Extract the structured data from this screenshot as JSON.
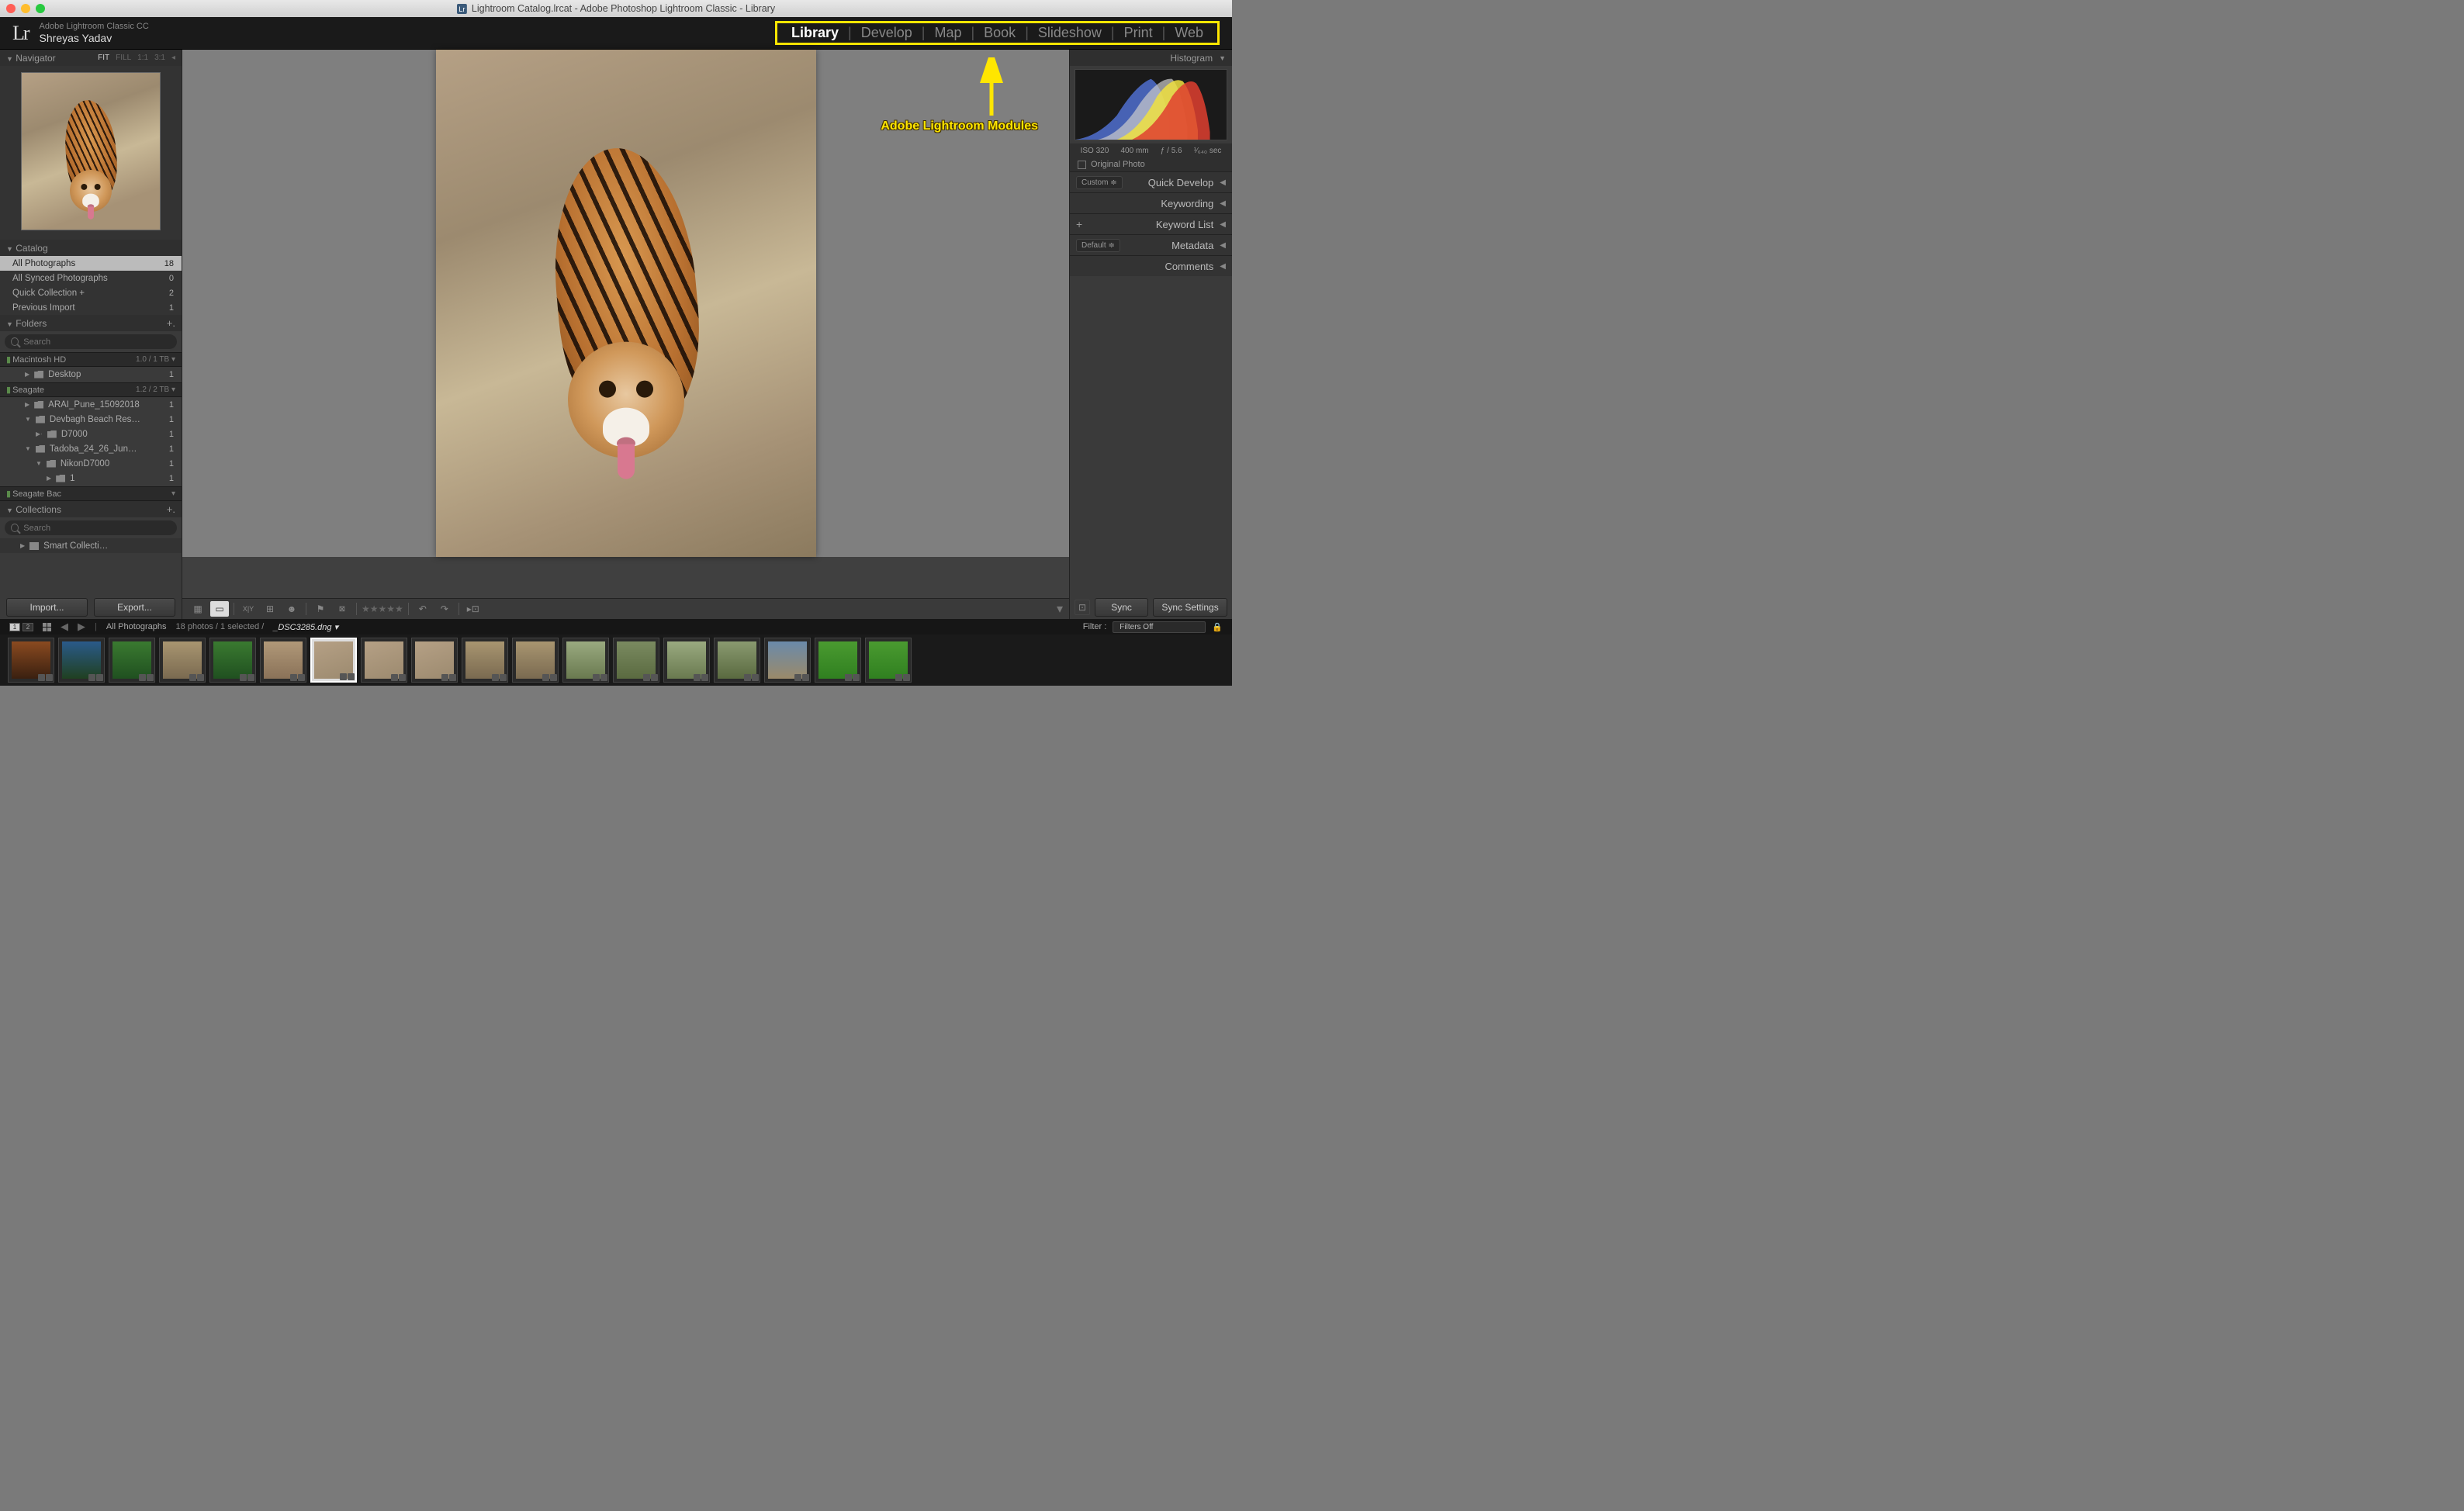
{
  "titlebar": {
    "title": "Lightroom Catalog.lrcat - Adobe Photoshop Lightroom Classic - Library"
  },
  "identity": {
    "app": "Adobe Lightroom Classic CC",
    "user": "Shreyas Yadav",
    "logo": "Lr"
  },
  "modules": [
    "Library",
    "Develop",
    "Map",
    "Book",
    "Slideshow",
    "Print",
    "Web"
  ],
  "active_module": "Library",
  "annotation_label": "Adobe Lightroom Modules",
  "navigator": {
    "title": "Navigator",
    "fit_options": [
      "FIT",
      "FILL",
      "1:1",
      "3:1"
    ],
    "fit_active": "FIT"
  },
  "catalog": {
    "title": "Catalog",
    "items": [
      {
        "label": "All Photographs",
        "count": "18",
        "selected": true
      },
      {
        "label": "All Synced Photographs",
        "count": "0"
      },
      {
        "label": "Quick Collection  +",
        "count": "2"
      },
      {
        "label": "Previous Import",
        "count": "1"
      }
    ]
  },
  "folders": {
    "title": "Folders",
    "search_placeholder": "Search",
    "drives": [
      {
        "name": "Macintosh HD",
        "usage": "1.0 / 1 TB",
        "items": [
          {
            "label": "Desktop",
            "count": "1",
            "indent": 0,
            "exp": "▶"
          }
        ]
      },
      {
        "name": "Seagate",
        "usage": "1.2 / 2 TB",
        "items": [
          {
            "label": "ARAI_Pune_15092018",
            "count": "1",
            "indent": 0,
            "exp": "▶"
          },
          {
            "label": "Devbagh Beach Res…",
            "count": "1",
            "indent": 0,
            "exp": "▼"
          },
          {
            "label": "D7000",
            "count": "1",
            "indent": 1,
            "exp": "▶·"
          },
          {
            "label": "Tadoba_24_26_Jun…",
            "count": "1",
            "indent": 0,
            "exp": "▼"
          },
          {
            "label": "NikonD7000",
            "count": "1",
            "indent": 1,
            "exp": "▼"
          },
          {
            "label": "1",
            "count": "1",
            "indent": 2,
            "exp": "▶"
          }
        ]
      },
      {
        "name": "Seagate Bac",
        "usage": "",
        "items": []
      }
    ]
  },
  "collections": {
    "title": "Collections",
    "search_placeholder": "Search",
    "items": [
      {
        "label": "Smart Collecti…",
        "exp": "▶"
      }
    ]
  },
  "left_buttons": {
    "import": "Import...",
    "export": "Export..."
  },
  "histogram": {
    "title": "Histogram",
    "meta": {
      "iso": "ISO 320",
      "focal": "400 mm",
      "aperture": "ƒ / 5.6",
      "shutter": "¹⁄₆₄₀ sec"
    },
    "original_label": "Original Photo"
  },
  "right_panels": [
    {
      "label": "Quick Develop",
      "select": "Custom"
    },
    {
      "label": "Keywording"
    },
    {
      "label": "Keyword List",
      "plus": true
    },
    {
      "label": "Metadata",
      "select": "Default"
    },
    {
      "label": "Comments"
    }
  ],
  "right_buttons": {
    "sync": "Sync",
    "settings": "Sync Settings"
  },
  "filmstrip_header": {
    "source": "All Photographs",
    "count_text": "18 photos / 1 selected /",
    "filename": "_DSC3285.dng",
    "filter_label": "Filter :",
    "filter_value": "Filters Off"
  },
  "thumbnails": [
    {
      "bg": "linear-gradient(#8a4a20,#3a2010)"
    },
    {
      "bg": "linear-gradient(#2a5a8a,#204020)"
    },
    {
      "bg": "linear-gradient(#3a7a30,#205020)"
    },
    {
      "bg": "linear-gradient(#a89570,#7a6a50)"
    },
    {
      "bg": "linear-gradient(#3a7a30,#205020)"
    },
    {
      "bg": "linear-gradient(#b09878,#8a7258)"
    },
    {
      "bg": "linear-gradient(160deg,#b5a085,#9c8a6f)",
      "sel": true
    },
    {
      "bg": "linear-gradient(160deg,#b5a085,#9c8a6f)"
    },
    {
      "bg": "linear-gradient(160deg,#b5a085,#9c8a6f)"
    },
    {
      "bg": "linear-gradient(#a89570,#7a6a50)"
    },
    {
      "bg": "linear-gradient(#a89570,#7a6a50)"
    },
    {
      "bg": "linear-gradient(#9aaa80,#6a7a50)"
    },
    {
      "bg": "linear-gradient(#7a8a60,#5a6a40)"
    },
    {
      "bg": "linear-gradient(#9aaa80,#6a7a50)"
    },
    {
      "bg": "linear-gradient(#8a9a70,#5a6a40)"
    },
    {
      "bg": "linear-gradient(#6a8aaa,#9a8a6a)"
    },
    {
      "bg": "linear-gradient(#4a9a30,#308020)"
    },
    {
      "bg": "linear-gradient(#4a9a30,#308020)"
    }
  ]
}
